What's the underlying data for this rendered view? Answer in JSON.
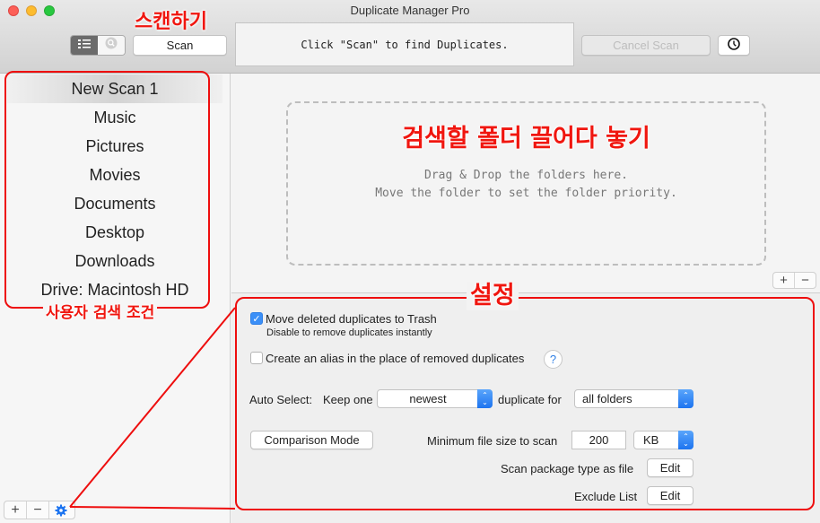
{
  "window": {
    "title": "Duplicate Manager Pro"
  },
  "toolbar": {
    "view_list_icon": "list-icon",
    "view_search_icon": "search-icon",
    "scan_label": "Scan",
    "status_text": "Click \"Scan\" to find Duplicates.",
    "cancel_scan_label": "Cancel Scan",
    "history_icon": "clock-icon"
  },
  "annotations": {
    "scan": "스캔하기",
    "drag_drop": "검색할 폴더 끌어다 놓기",
    "settings": "설정",
    "user_conditions": "사용자 검색 조건",
    "accent_color": "#f0160f"
  },
  "sidebar": {
    "items": [
      {
        "label": "New Scan 1",
        "selected": true
      },
      {
        "label": "Music",
        "selected": false
      },
      {
        "label": "Pictures",
        "selected": false
      },
      {
        "label": "Movies",
        "selected": false
      },
      {
        "label": "Documents",
        "selected": false
      },
      {
        "label": "Desktop",
        "selected": false
      },
      {
        "label": "Downloads",
        "selected": false
      },
      {
        "label": "Drive: Macintosh HD",
        "selected": false
      }
    ],
    "add_label": "+",
    "remove_label": "−",
    "settings_icon": "gear-icon"
  },
  "dropzone": {
    "line1": "Drag & Drop the folders here.",
    "line2": "Move the folder to set the folder priority.",
    "add_label": "+",
    "remove_label": "−"
  },
  "settings": {
    "move_to_trash": {
      "label": "Move deleted duplicates to Trash",
      "hint": "Disable to remove duplicates instantly",
      "checked": true
    },
    "create_alias": {
      "label": "Create an alias in the place of removed duplicates",
      "checked": false,
      "help": "?"
    },
    "auto_select_label": "Auto Select:",
    "keep_one_label": "Keep one",
    "keep_one_value": "newest",
    "duplicate_for_label": "duplicate for",
    "duplicate_for_value": "all folders",
    "comparison_mode_label": "Comparison Mode",
    "min_size_label": "Minimum file size to scan",
    "min_size_value": "200",
    "min_size_unit": "KB",
    "package_label": "Scan package type as file",
    "package_edit": "Edit",
    "exclude_label": "Exclude List",
    "exclude_edit": "Edit"
  }
}
